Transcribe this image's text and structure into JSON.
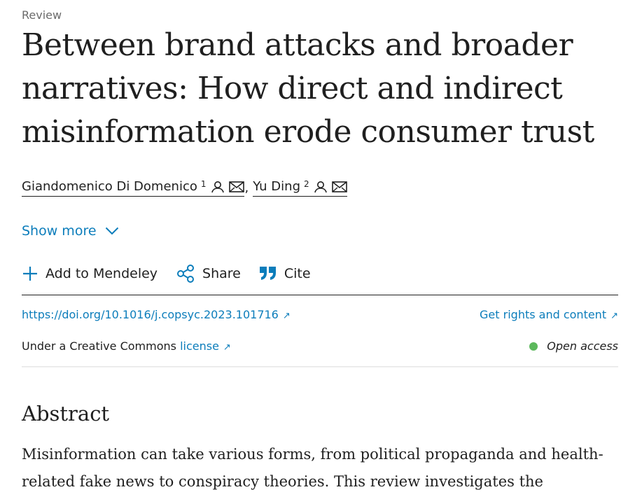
{
  "article": {
    "type": "Review",
    "title": "Between brand attacks and broader narratives: How direct and indirect misinformation erode consumer trust"
  },
  "authors": [
    {
      "name": "Giandomenico Di Domenico",
      "sup": "1"
    },
    {
      "name": "Yu Ding",
      "sup": "2"
    }
  ],
  "author_separator": ",",
  "show_more": "Show more",
  "actions": {
    "mendeley": "Add to Mendeley",
    "share": "Share",
    "cite": "Cite"
  },
  "doi": "https://doi.org/10.1016/j.copsyc.2023.101716",
  "rights": "Get rights and content",
  "license": {
    "prefix": "Under a Creative Commons",
    "link": "license"
  },
  "open_access": "Open access",
  "abstract": {
    "heading": "Abstract",
    "text": "Misinformation can take various forms, from political propaganda and health-related fake news to conspiracy theories. This review investigates the"
  },
  "colors": {
    "link": "#0c7dbb",
    "text": "#1f1f1f",
    "open_access_dot": "#5cb85c"
  }
}
